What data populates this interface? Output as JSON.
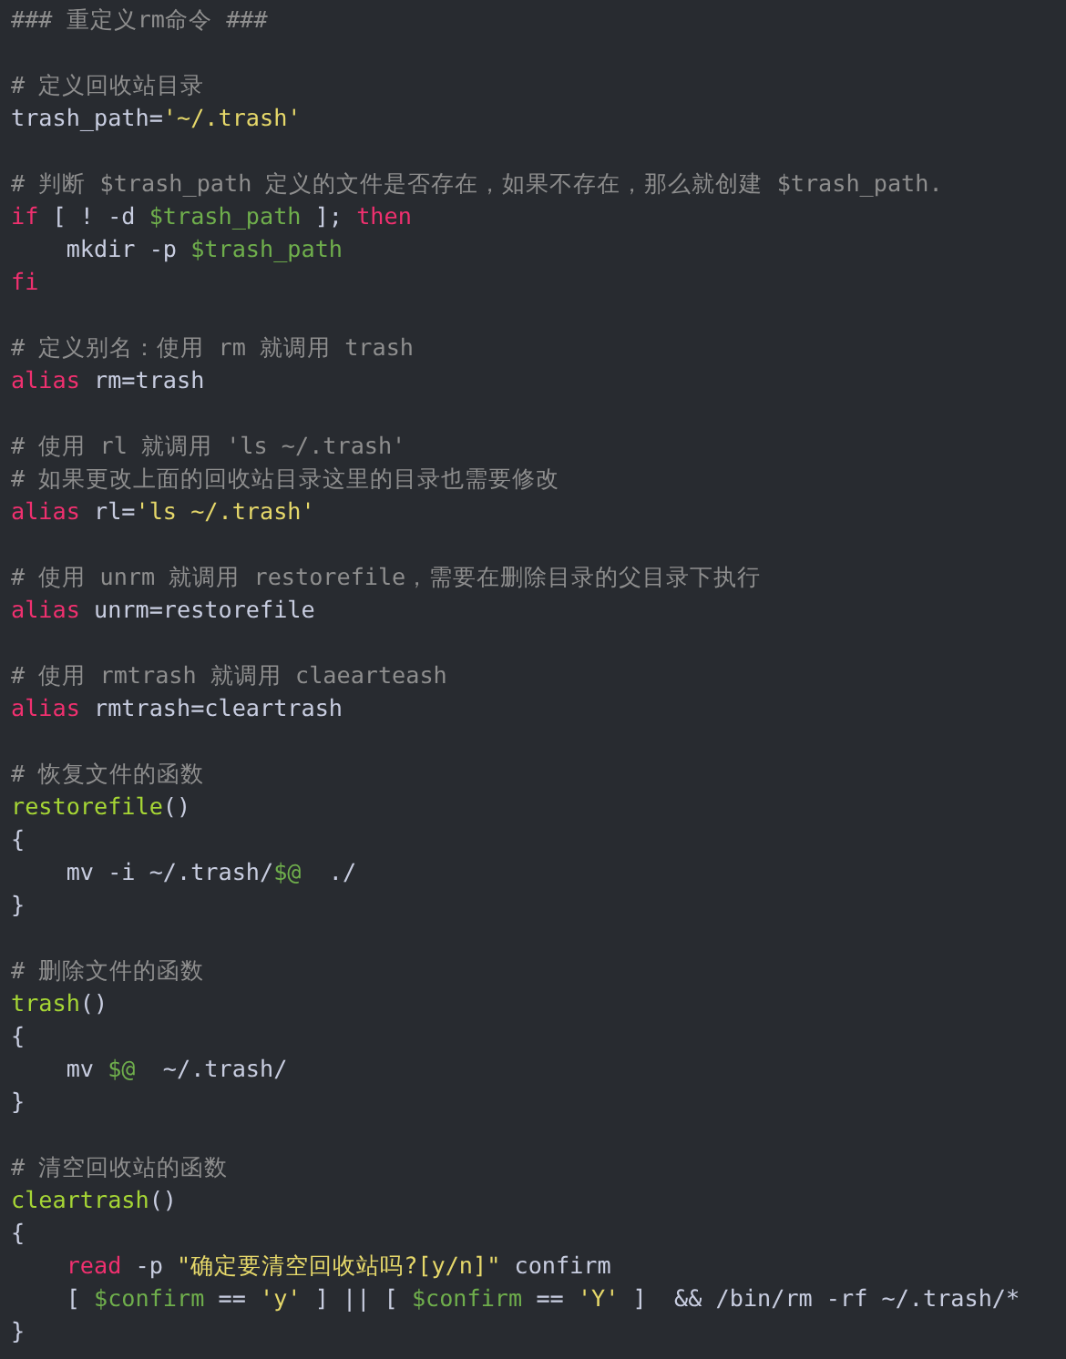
{
  "lines": [
    {
      "kind": "code",
      "tokens": [
        {
          "kind": "comment",
          "text": "### 重定义rm命令 ###"
        }
      ]
    },
    {
      "kind": "blank"
    },
    {
      "kind": "code",
      "tokens": [
        {
          "kind": "comment",
          "text": "# 定义回收站目录"
        }
      ]
    },
    {
      "kind": "code",
      "tokens": [
        {
          "kind": "plain",
          "text": "trash_path="
        },
        {
          "kind": "string",
          "text": "'~/.trash'"
        }
      ]
    },
    {
      "kind": "blank"
    },
    {
      "kind": "code",
      "tokens": [
        {
          "kind": "comment",
          "text": "# 判断 $trash_path 定义的文件是否存在，如果不存在，那么就创建 $trash_path."
        }
      ]
    },
    {
      "kind": "code",
      "tokens": [
        {
          "kind": "keyword",
          "text": "if"
        },
        {
          "kind": "plain",
          "text": " [ ! -d "
        },
        {
          "kind": "variable",
          "text": "$trash_path"
        },
        {
          "kind": "plain",
          "text": " ]; "
        },
        {
          "kind": "keyword",
          "text": "then"
        }
      ]
    },
    {
      "kind": "code",
      "tokens": [
        {
          "kind": "plain",
          "text": "    mkdir -p "
        },
        {
          "kind": "variable",
          "text": "$trash_path"
        }
      ]
    },
    {
      "kind": "code",
      "tokens": [
        {
          "kind": "keyword",
          "text": "fi"
        }
      ]
    },
    {
      "kind": "blank"
    },
    {
      "kind": "code",
      "tokens": [
        {
          "kind": "comment",
          "text": "# 定义别名：使用 rm 就调用 trash"
        }
      ]
    },
    {
      "kind": "code",
      "tokens": [
        {
          "kind": "keyword",
          "text": "alias"
        },
        {
          "kind": "plain",
          "text": " rm=trash"
        }
      ]
    },
    {
      "kind": "blank"
    },
    {
      "kind": "code",
      "tokens": [
        {
          "kind": "comment",
          "text": "# 使用 rl 就调用 'ls ~/.trash'"
        }
      ]
    },
    {
      "kind": "code",
      "tokens": [
        {
          "kind": "comment",
          "text": "# 如果更改上面的回收站目录这里的目录也需要修改"
        }
      ]
    },
    {
      "kind": "code",
      "tokens": [
        {
          "kind": "keyword",
          "text": "alias"
        },
        {
          "kind": "plain",
          "text": " rl="
        },
        {
          "kind": "string",
          "text": "'ls ~/.trash'"
        }
      ]
    },
    {
      "kind": "blank"
    },
    {
      "kind": "code",
      "tokens": [
        {
          "kind": "comment",
          "text": "# 使用 unrm 就调用 restorefile，需要在删除目录的父目录下执行"
        }
      ]
    },
    {
      "kind": "code",
      "tokens": [
        {
          "kind": "keyword",
          "text": "alias"
        },
        {
          "kind": "plain",
          "text": " unrm=restorefile"
        }
      ]
    },
    {
      "kind": "blank"
    },
    {
      "kind": "code",
      "tokens": [
        {
          "kind": "comment",
          "text": "# 使用 rmtrash 就调用 claearteash"
        }
      ]
    },
    {
      "kind": "code",
      "tokens": [
        {
          "kind": "keyword",
          "text": "alias"
        },
        {
          "kind": "plain",
          "text": " rmtrash=cleartrash"
        }
      ]
    },
    {
      "kind": "blank"
    },
    {
      "kind": "code",
      "tokens": [
        {
          "kind": "comment",
          "text": "# 恢复文件的函数"
        }
      ]
    },
    {
      "kind": "code",
      "tokens": [
        {
          "kind": "function",
          "text": "restorefile"
        },
        {
          "kind": "plain",
          "text": "()"
        }
      ]
    },
    {
      "kind": "code",
      "tokens": [
        {
          "kind": "plain",
          "text": "{"
        }
      ]
    },
    {
      "kind": "code",
      "tokens": [
        {
          "kind": "plain",
          "text": "    mv -i ~/.trash/"
        },
        {
          "kind": "variable",
          "text": "$@"
        },
        {
          "kind": "plain",
          "text": "  ./"
        }
      ]
    },
    {
      "kind": "code",
      "tokens": [
        {
          "kind": "plain",
          "text": "}"
        }
      ]
    },
    {
      "kind": "blank"
    },
    {
      "kind": "code",
      "tokens": [
        {
          "kind": "comment",
          "text": "# 删除文件的函数"
        }
      ]
    },
    {
      "kind": "code",
      "tokens": [
        {
          "kind": "function",
          "text": "trash"
        },
        {
          "kind": "plain",
          "text": "()"
        }
      ]
    },
    {
      "kind": "code",
      "tokens": [
        {
          "kind": "plain",
          "text": "{"
        }
      ]
    },
    {
      "kind": "code",
      "tokens": [
        {
          "kind": "plain",
          "text": "    mv "
        },
        {
          "kind": "variable",
          "text": "$@"
        },
        {
          "kind": "plain",
          "text": "  ~/.trash/"
        }
      ]
    },
    {
      "kind": "code",
      "tokens": [
        {
          "kind": "plain",
          "text": "}"
        }
      ]
    },
    {
      "kind": "blank"
    },
    {
      "kind": "code",
      "tokens": [
        {
          "kind": "comment",
          "text": "# 清空回收站的函数"
        }
      ]
    },
    {
      "kind": "code",
      "tokens": [
        {
          "kind": "function",
          "text": "cleartrash"
        },
        {
          "kind": "plain",
          "text": "()"
        }
      ]
    },
    {
      "kind": "code",
      "tokens": [
        {
          "kind": "plain",
          "text": "{"
        }
      ]
    },
    {
      "kind": "code",
      "tokens": [
        {
          "kind": "keyword",
          "text": "    read"
        },
        {
          "kind": "plain",
          "text": " -p "
        },
        {
          "kind": "string",
          "text": "\"确定要清空回收站吗?[y/n]\""
        },
        {
          "kind": "plain",
          "text": " confirm"
        }
      ]
    },
    {
      "kind": "code",
      "tokens": [
        {
          "kind": "plain",
          "text": "    [ "
        },
        {
          "kind": "variable",
          "text": "$confirm"
        },
        {
          "kind": "plain",
          "text": " == "
        },
        {
          "kind": "string",
          "text": "'y'"
        },
        {
          "kind": "plain",
          "text": " ] || [ "
        },
        {
          "kind": "variable",
          "text": "$confirm"
        },
        {
          "kind": "plain",
          "text": " == "
        },
        {
          "kind": "string",
          "text": "'Y'"
        },
        {
          "kind": "plain",
          "text": " ]  && /bin/rm -rf ~/.trash/*"
        }
      ]
    },
    {
      "kind": "code",
      "tokens": [
        {
          "kind": "plain",
          "text": "}"
        }
      ]
    }
  ]
}
